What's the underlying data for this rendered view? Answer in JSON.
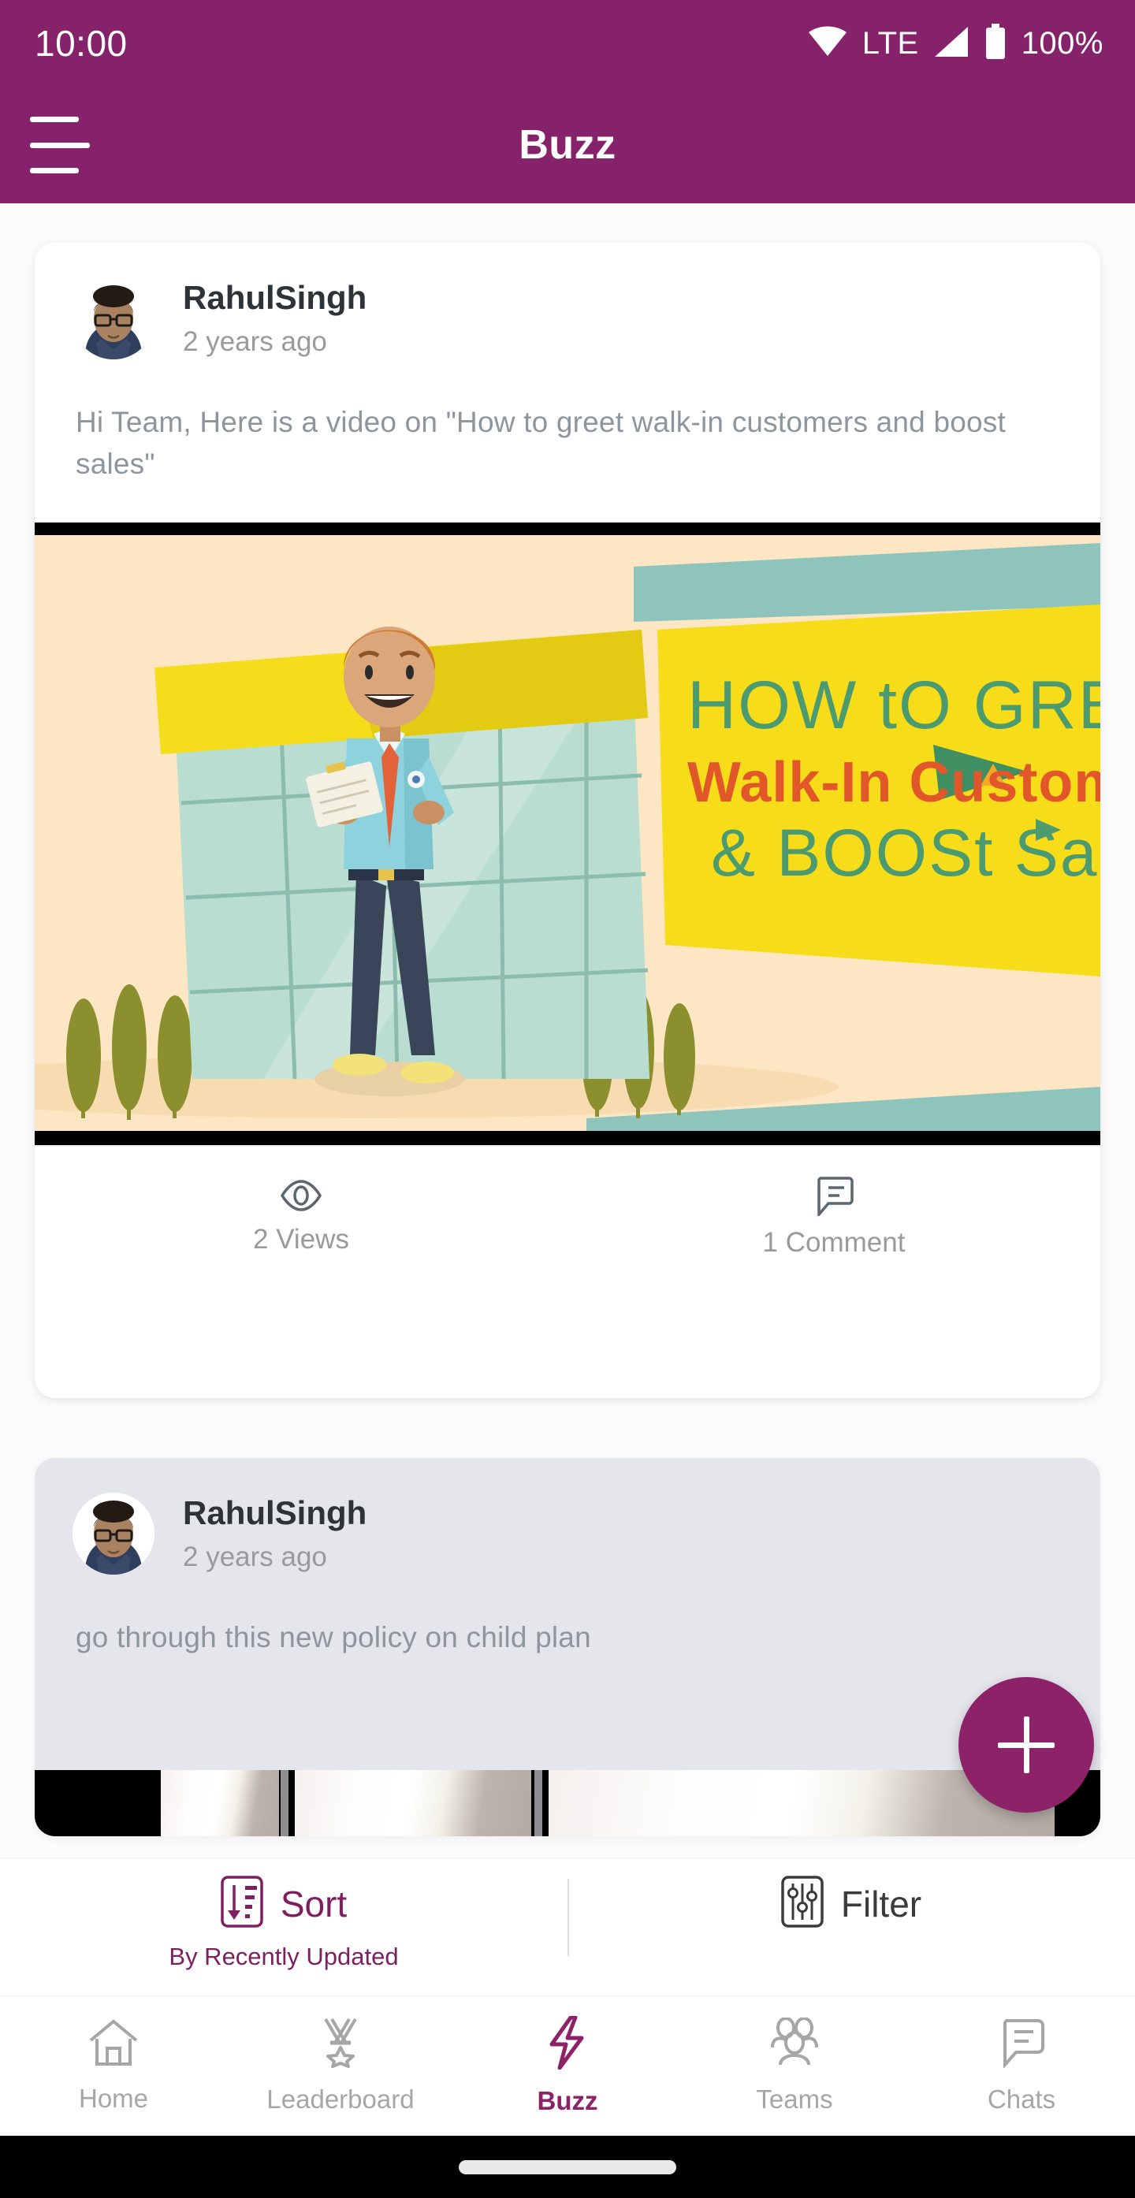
{
  "status_bar": {
    "time": "10:00",
    "network_label": "LTE",
    "battery_percent": "100%",
    "icons": [
      "wifi-icon",
      "signal-icon",
      "battery-icon"
    ]
  },
  "app_bar": {
    "title": "Buzz",
    "menu_icon": "hamburger-menu-icon"
  },
  "feed": {
    "posts": [
      {
        "author": "RahulSingh",
        "timestamp": "2 years ago",
        "text": "Hi Team, Here is a video on \"How to greet walk-in customers and boost sales\"",
        "media_type": "video-thumbnail",
        "media_caption_lines": [
          "HOW tO GREEt",
          "Walk-In CustomerS",
          "& BOOSt SaleS"
        ],
        "views_label": "2 Views",
        "comments_label": "1 Comment",
        "views_icon": "eye-icon",
        "comments_icon": "comment-bubble-icon"
      },
      {
        "author": "RahulSingh",
        "timestamp": "2 years ago",
        "text": "go through this  new policy on child plan",
        "media_type": "image"
      }
    ]
  },
  "fab": {
    "label": "+",
    "icon": "plus-icon",
    "color": "#8d2268"
  },
  "sort_filter": {
    "sort_label": "Sort",
    "sort_sublabel": "By Recently Updated",
    "sort_icon": "sort-descending-icon",
    "filter_label": "Filter",
    "filter_icon": "filter-sliders-icon"
  },
  "bottom_nav": {
    "items": [
      {
        "label": "Home",
        "icon": "home-icon",
        "active": false
      },
      {
        "label": "Leaderboard",
        "icon": "medal-icon",
        "active": false
      },
      {
        "label": "Buzz",
        "icon": "lightning-icon",
        "active": true
      },
      {
        "label": "Teams",
        "icon": "people-group-icon",
        "active": false
      },
      {
        "label": "Chats",
        "icon": "chat-bubble-icon",
        "active": false
      }
    ]
  },
  "theme": {
    "primary": "#85226a",
    "accent": "#8d2268",
    "muted_text": "#9a9a9e",
    "inactive_nav": "#a6a6a6"
  }
}
